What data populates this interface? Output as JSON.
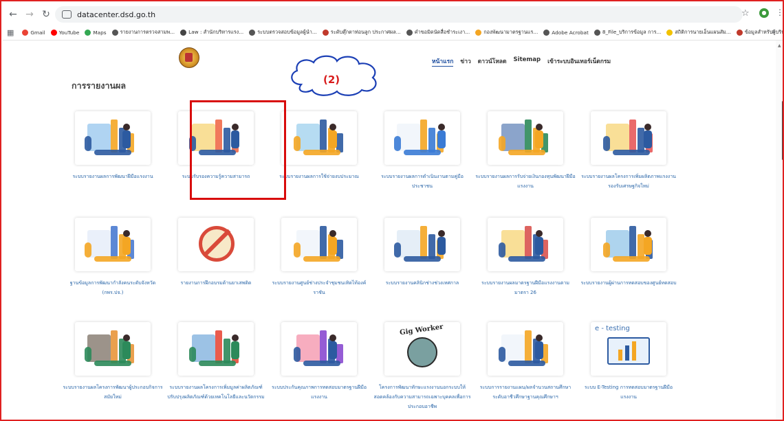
{
  "browser": {
    "url": "datacenter.dsd.go.th",
    "bookmarks": [
      {
        "label": "Gmail",
        "color": "#ea4335"
      },
      {
        "label": "YouTube",
        "color": "#ff0000"
      },
      {
        "label": "Maps",
        "color": "#34a853"
      },
      {
        "label": "รายงานการตรวจสามพ...",
        "color": "#555555"
      },
      {
        "label": "Law : สำนักบริหารแรง...",
        "color": "#444444"
      },
      {
        "label": "ระบบตรวจสอบข้อมูลผู้นำ...",
        "color": "#555555"
      },
      {
        "label": "ระดับตุ๊กตาท่อนลูก ประกาศผล...",
        "color": "#c0392b"
      },
      {
        "label": "คำขอมิดนัดสื่อชำระเงา...",
        "color": "#555555"
      },
      {
        "label": "กองพัฒนามาตรฐานแร...",
        "color": "#f4a623"
      },
      {
        "label": "Adobe Acrobat",
        "color": "#555555"
      },
      {
        "label": "8_File_บริการข้อมูล การ...",
        "color": "#555555"
      },
      {
        "label": "สถิติการนายเอ็นแผนสัม...",
        "color": "#f2c200"
      },
      {
        "label": "ข้อมูลสำหรับผู้บริหาร...",
        "color": "#c0392b"
      }
    ],
    "more": "»"
  },
  "nav": [
    "หน้าแรก",
    "ข่าว",
    "ดาวน์โหลด",
    "Sitemap",
    "เข้าระบบอินเทอร์เน็ตกรม"
  ],
  "section_title": "การรายงานผล",
  "callout_label": "(2)",
  "cards": [
    {
      "title": "ระบบรายงานผลการพัฒนาฝีมือแรงงาน",
      "icon": "analytics-illustration-icon"
    },
    {
      "title": "ระบบรับรองความรู้ความสามารถ",
      "icon": "books-trophy-illustration-icon"
    },
    {
      "title": "ระบบรายงานผลการใช้จ่ายงบประมาณ",
      "icon": "budget-boxes-illustration-icon"
    },
    {
      "title": "ระบบรายงานผลการดำเนินงานตามคู่มือประชาชน",
      "icon": "presentation-illustration-icon"
    },
    {
      "title": "ระบบรายงานผลการรับจ่ายเงินกองทุนพัฒนาฝีมือแรงงาน",
      "icon": "money-chart-illustration-icon"
    },
    {
      "title": "ระบบรายงานผลโครงการเพิ่มผลิตภาพแรงงานรองรับเศรษฐกิจใหม่",
      "icon": "productivity-illustration-icon"
    },
    {
      "title": "ฐานข้อมูลการพัฒนากำลังคนระดับจังหวัด (กพร.ปจ.)",
      "icon": "team-meeting-illustration-icon"
    },
    {
      "title": "รายงานการฝึกอบรมต้านยาเสพติด",
      "icon": "no-drugs-illustration-icon"
    },
    {
      "title": "ระบบรายงานศูนย์ช่างประจำชุมชนเทิดไท้องค์ราชัน",
      "icon": "repair-tools-illustration-icon"
    },
    {
      "title": "ระบบรายงานคลินิกช่างช่วงเทศกาล",
      "icon": "data-board-illustration-icon"
    },
    {
      "title": "ระบบรายงานผลมาตรฐานฝีมือแรงงานตามมาตรา 26",
      "icon": "standards-illustration-icon"
    },
    {
      "title": "ระบบรายงานผู้ผ่านการทดสอบของศูนย์ทดสอบ",
      "icon": "certificate-test-illustration-icon"
    },
    {
      "title": "ระบบรายงานผลโครงการพัฒนาผู้ประกอบกิจการสมัยใหม่",
      "icon": "shop-illustration-icon"
    },
    {
      "title": "ระบบรายงานผลโครงการเพิ่มมูลค่าผลิตภัณฑ์ปรับปรุงผลิตภัณฑ์ด้วยเทคโนโลยีและนวัตกรรม",
      "icon": "growth-plant-illustration-icon"
    },
    {
      "title": "ระบบประกันคุณภาพการทดสอบมาตรฐานฝีมือแรงงาน",
      "icon": "laptop-books-illustration-icon"
    },
    {
      "title": "โครงการพัฒนาทักษะแรงงานนอกระบบให้สอดคล้องกับความสามารถเฉพาะบุคคลเพื่อการประกอบอาชีพ",
      "icon": "gig-worker-logo-icon",
      "image_text": "Gig Worker"
    },
    {
      "title": "ระบบการรายงานแผน/ผลจำนวนสถานศึกษาระดับอาชีวศึกษาฐานคุณศึกษาฯ",
      "icon": "students-illustration-icon"
    },
    {
      "title": "ระบบ E-Testing การทดสอบมาตรฐานฝีมือแรงงาน",
      "icon": "e-testing-illustration-icon",
      "image_text": "e - testing"
    }
  ]
}
